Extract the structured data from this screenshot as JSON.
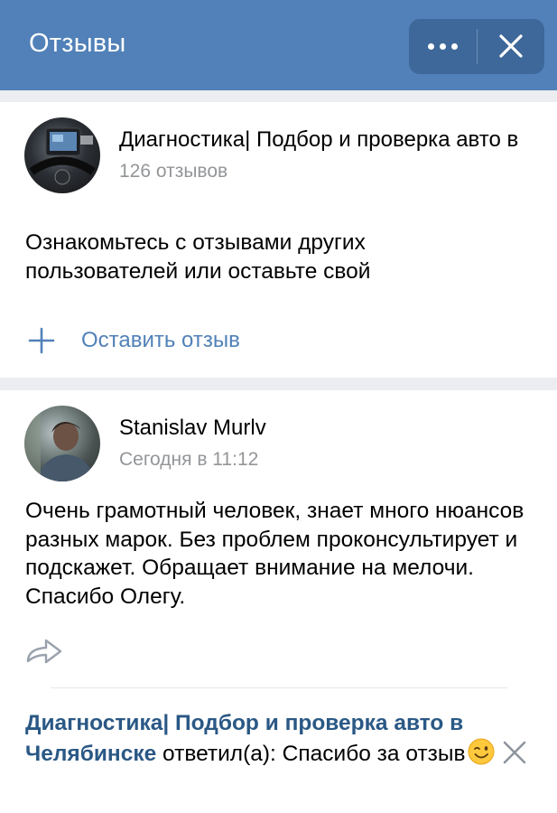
{
  "header": {
    "title": "Отзывы",
    "more_icon": "more-horizontal-icon",
    "close_icon": "close-icon"
  },
  "group": {
    "name": "Диагностика| Подбор и проверка авто в Челябинске",
    "review_count": "126 отзывов",
    "intro": "Ознакомьтесь с отзывами других пользователей или оставьте свой",
    "leave_review_label": "Оставить отзыв",
    "add_icon": "plus-icon"
  },
  "review": {
    "author": "Stanislav Murlv",
    "time": "Сегодня в 11:12",
    "text": "Очень грамотный человек, знает много нюансов разных марок. Без проблем проконсультирует и подскажет. Обращает внимание на мелочи. Спасибо Олегу.",
    "share_icon": "share-icon",
    "reply": {
      "author": "Диагностика| Подбор и проверка авто в Челябинске",
      "verb": "ответил(а):",
      "text": "Спасибо за отзыв",
      "emoji": "winking-face-emoji",
      "delete_icon": "close-icon"
    }
  },
  "colors": {
    "header_bg": "#5181b8",
    "accent": "#5181b8",
    "link": "#2a5885",
    "secondary_text": "#939699",
    "page_bg": "#ebedf0"
  }
}
